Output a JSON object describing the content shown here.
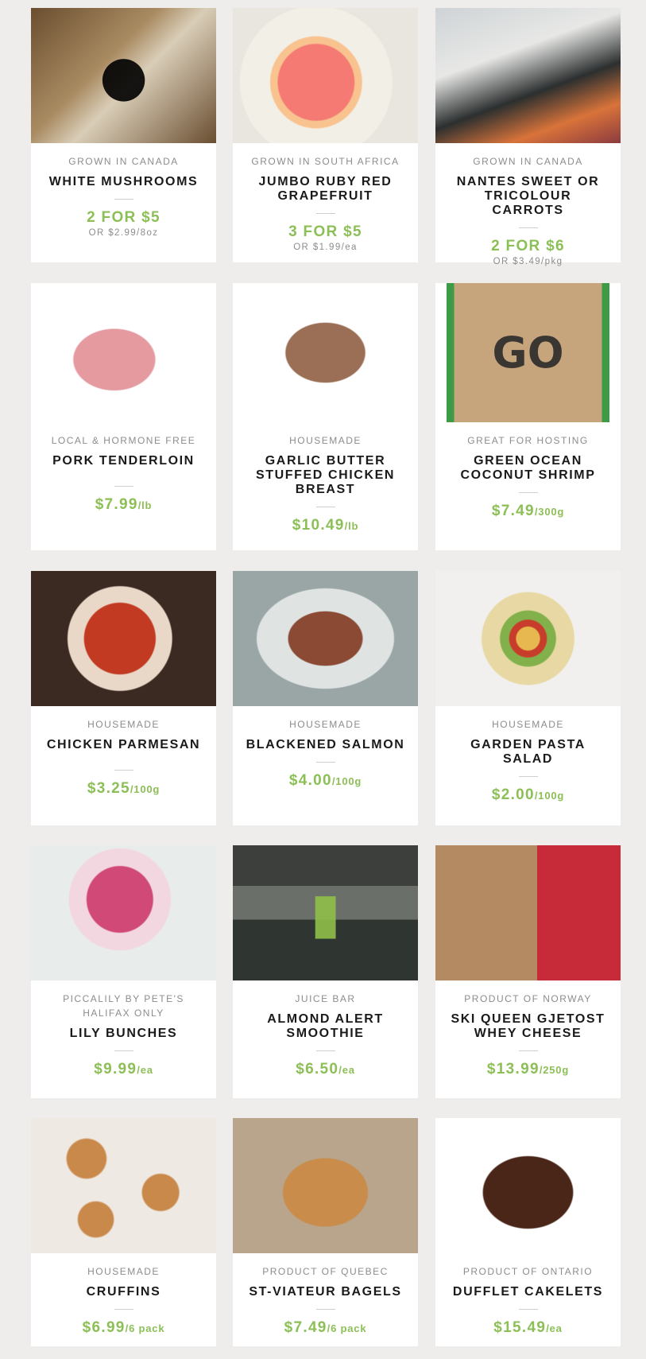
{
  "products": [
    {
      "origin": "GROWN IN CANADA",
      "name": "WHITE MUSHROOMS",
      "price": "2 FOR $5",
      "unit": "",
      "alt_prefix": "OR $2.99",
      "alt_unit": "/8oz",
      "icon": "mushroom-icon"
    },
    {
      "origin": "GROWN IN SOUTH AFRICA",
      "name": "JUMBO RUBY RED GRAPEFRUIT",
      "price": "3 FOR $5",
      "unit": "",
      "alt_prefix": "OR $1.99",
      "alt_unit": "/ea",
      "icon": "grapefruit-icon"
    },
    {
      "origin": "GROWN IN CANADA",
      "name": "NANTES SWEET OR TRICOLOUR CARROTS",
      "price": "2 FOR $6",
      "unit": "",
      "alt_prefix": "OR $3.49",
      "alt_unit": "/pkg",
      "icon": "carrot-icon"
    },
    {
      "origin": "LOCAL & HORMONE FREE",
      "name": "PORK TENDERLOIN",
      "price": "$7.99",
      "unit": "/lb",
      "icon": "meat-icon"
    },
    {
      "origin": "HOUSEMADE",
      "name": "GARLIC BUTTER STUFFED CHICKEN BREAST",
      "price": "$10.49",
      "unit": "/lb",
      "icon": "chicken-icon"
    },
    {
      "origin": "GREAT FOR HOSTING",
      "name": "GREEN OCEAN COCONUT SHRIMP",
      "price": "$7.49",
      "unit": "/300g",
      "icon": "shrimp-box-icon"
    },
    {
      "origin": "HOUSEMADE",
      "name": "CHICKEN PARMESAN",
      "price": "$3.25",
      "unit": "/100g",
      "icon": "dish-icon"
    },
    {
      "origin": "HOUSEMADE",
      "name": "BLACKENED SALMON",
      "price": "$4.00",
      "unit": "/100g",
      "icon": "fish-icon"
    },
    {
      "origin": "HOUSEMADE",
      "name": "GARDEN PASTA SALAD",
      "price": "$2.00",
      "unit": "/100g",
      "icon": "salad-icon"
    },
    {
      "origin": "PICCALILY BY PETE'S HALIFAX ONLY",
      "name": "LILY BUNCHES",
      "price": "$9.99",
      "unit": "/ea",
      "icon": "flower-icon"
    },
    {
      "origin": "JUICE BAR",
      "name": "ALMOND ALERT SMOOTHIE",
      "price": "$6.50",
      "unit": "/ea",
      "icon": "cup-icon"
    },
    {
      "origin": "PRODUCT OF NORWAY",
      "name": "SKI QUEEN GJETOST WHEY CHEESE",
      "price": "$13.99",
      "unit": "/250g",
      "icon": "cheese-icon"
    },
    {
      "origin": "HOUSEMADE",
      "name": "CRUFFINS",
      "price": "$6.99",
      "unit": "/6 pack",
      "icon": "pastry-icon"
    },
    {
      "origin": "PRODUCT OF QUEBEC",
      "name": "ST-VIATEUR BAGELS",
      "price": "$7.49",
      "unit": "/6 pack",
      "icon": "bagel-icon"
    },
    {
      "origin": "PRODUCT OF ONTARIO",
      "name": "DUFFLET CAKELETS",
      "price": "$15.49",
      "unit": "/ea",
      "icon": "cake-icon"
    }
  ]
}
